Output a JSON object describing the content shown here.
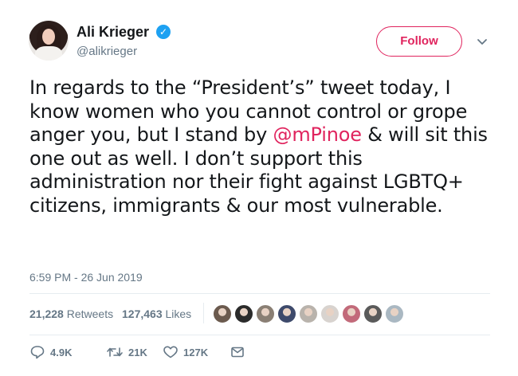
{
  "author": {
    "name": "Ali Krieger",
    "handle": "@alikrieger",
    "verified_icon": "verified-badge-icon"
  },
  "follow_label": "Follow",
  "tweet": {
    "text_before": "In regards to the “President’s” tweet today, I know women who you cannot control or grope anger you, but I stand by ",
    "mention": "@mPinoe",
    "text_after": " & will sit this one out as well. I don’t support this administration nor their fight against LGBTQ+ citizens, immigrants & our most vulnerable.",
    "timestamp": "6:59 PM - 26 Jun 2019"
  },
  "stats": {
    "retweets_count": "21,228",
    "retweets_label": "Retweets",
    "likes_count": "127,463",
    "likes_label": "Likes"
  },
  "likers": [
    {
      "color": "#6b5a4e"
    },
    {
      "color": "#2b2b2b"
    },
    {
      "color": "#8a7f74"
    },
    {
      "color": "#3e4a6b"
    },
    {
      "color": "#b9b3ac"
    },
    {
      "color": "#d8d3cf"
    },
    {
      "color": "#c26a7a"
    },
    {
      "color": "#5a5a5a"
    },
    {
      "color": "#aab8c2"
    }
  ],
  "actions": {
    "reply_count": "4.9K",
    "retweet_count": "21K",
    "like_count": "127K"
  },
  "colors": {
    "accent": "#e0245e",
    "verified": "#1da1f2",
    "secondary_text": "#657786"
  }
}
